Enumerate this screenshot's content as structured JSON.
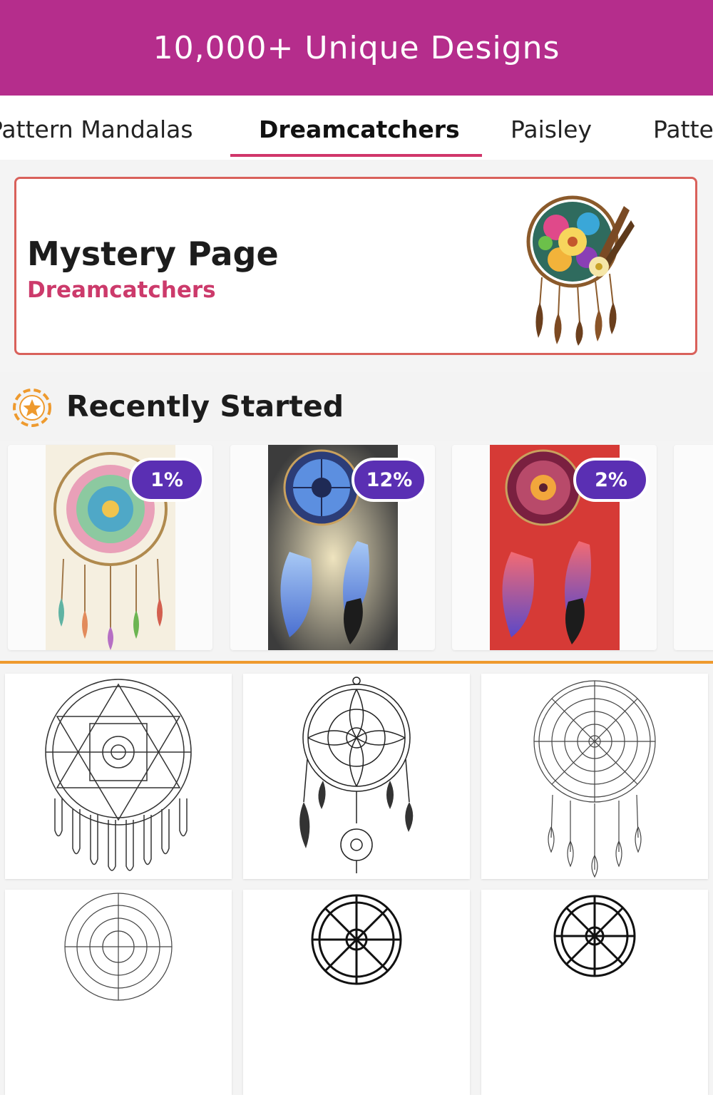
{
  "banner": {
    "title": "10,000+ Unique Designs",
    "color": "#b52d8c"
  },
  "tabs": [
    {
      "label": "Pattern Mandalas",
      "active": false
    },
    {
      "label": "Dreamcatchers",
      "active": true
    },
    {
      "label": "Paisley",
      "active": false
    },
    {
      "label": "Patte",
      "active": false
    }
  ],
  "mystery": {
    "title": "Mystery Page",
    "subtitle": "Dreamcatchers",
    "accent": "#cc3a6b",
    "icon": "dreamcatcher-colored-icon"
  },
  "recent": {
    "title": "Recently Started",
    "icon": "star-badge-icon",
    "items": [
      {
        "progress": "1%",
        "name": "dreamcatcher-feathered"
      },
      {
        "progress": "12%",
        "name": "dreamcatcher-blue"
      },
      {
        "progress": "2%",
        "name": "dreamcatcher-red"
      }
    ]
  },
  "accent_orange": "#ee9a2e",
  "badge_color": "#5a2fb3",
  "grid": {
    "items": [
      "dreamcatcher-1",
      "dreamcatcher-2",
      "dreamcatcher-3",
      "dreamcatcher-4",
      "dreamcatcher-5",
      "dreamcatcher-6"
    ]
  }
}
